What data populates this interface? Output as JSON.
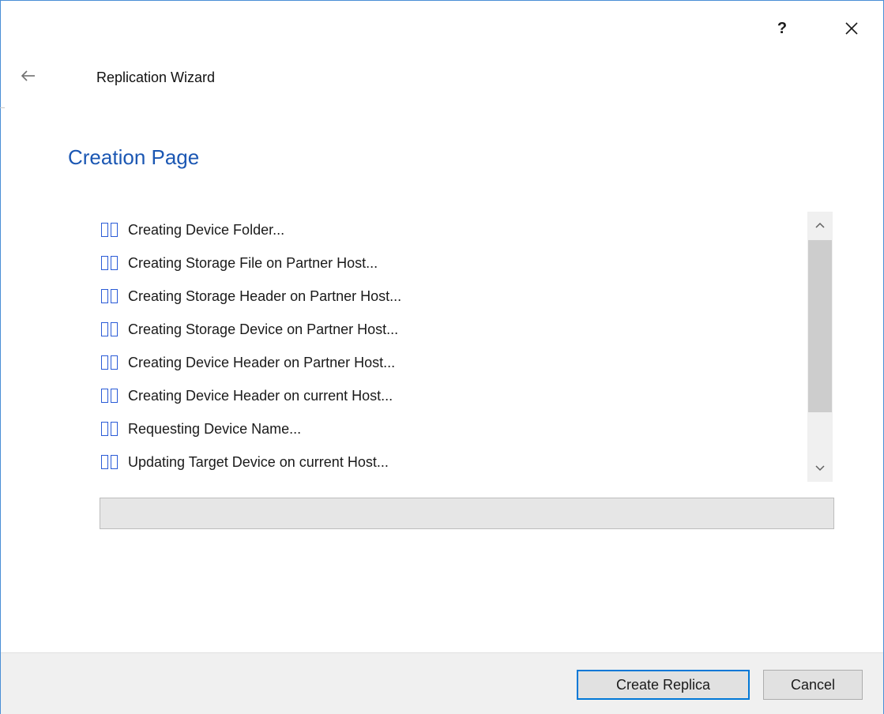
{
  "window": {
    "help_label": "?",
    "wizard_title": "Replication Wizard",
    "page_title": "Creation Page"
  },
  "log": {
    "items": [
      "Creating Device Folder...",
      "Creating Storage File on Partner Host...",
      "Creating Storage Header on Partner Host...",
      "Creating Storage Device on Partner Host...",
      "Creating Device Header on Partner Host...",
      "Creating Device Header on current Host...",
      "Requesting Device Name...",
      "Updating Target Device on current Host..."
    ],
    "item_icon": "missing-glyph-boxes"
  },
  "progress": {
    "value": 0
  },
  "buttons": {
    "create_label": "Create Replica",
    "cancel_label": "Cancel"
  },
  "colors": {
    "accent": "#0078d7",
    "title_blue": "#1b57b3",
    "window_border": "#4a8fd6",
    "glyph_blue": "#2a5bd7"
  },
  "icons": {
    "back": "back-arrow-icon",
    "close": "close-icon",
    "scroll_up": "chevron-up-icon",
    "scroll_down": "chevron-down-icon"
  }
}
